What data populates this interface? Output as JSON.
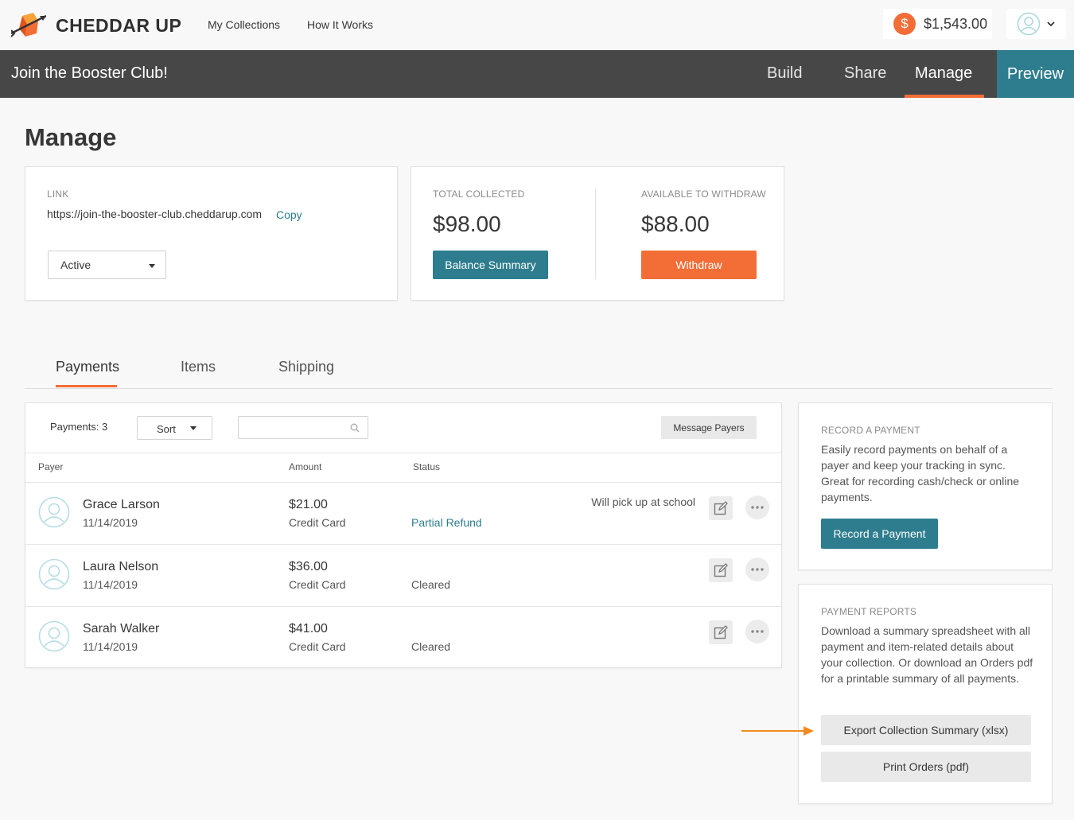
{
  "brand": {
    "name": "CHEDDAR UP",
    "accent": "#f36d36",
    "teal": "#2d7d8e"
  },
  "topnav": {
    "my_collections": "My Collections",
    "how_it_works": "How It Works"
  },
  "account": {
    "balance": "$1,543.00",
    "currency_icon": "$"
  },
  "collection": {
    "title": "Join the Booster Club!",
    "tabs": [
      "Build",
      "Share",
      "Manage",
      "Preview"
    ],
    "active_tab": "Manage"
  },
  "page": {
    "title": "Manage"
  },
  "link_card": {
    "label": "LINK",
    "url": "https://join-the-booster-club.cheddarup.com",
    "copy": "Copy",
    "status": "Active"
  },
  "totals": {
    "collected_label": "TOTAL COLLECTED",
    "collected": "$98.00",
    "balance_summary_btn": "Balance Summary",
    "available_label": "AVAILABLE TO WITHDRAW",
    "available": "$88.00",
    "withdraw_btn": "Withdraw"
  },
  "tabs": {
    "payments": "Payments",
    "items": "Items",
    "shipping": "Shipping",
    "active": "Payments"
  },
  "payments": {
    "count_label": "Payments: 3",
    "sort_label": "Sort",
    "search_placeholder": "",
    "message_btn": "Message Payers",
    "columns": {
      "payer": "Payer",
      "amount": "Amount",
      "status": "Status"
    },
    "rows": [
      {
        "name": "Grace Larson",
        "date": "11/14/2019",
        "amount": "$21.00",
        "method": "Credit Card",
        "status": "Partial Refund",
        "note": "Will pick up at school"
      },
      {
        "name": "Laura Nelson",
        "date": "11/14/2019",
        "amount": "$36.00",
        "method": "Credit Card",
        "status": "Cleared",
        "note": ""
      },
      {
        "name": "Sarah Walker",
        "date": "11/14/2019",
        "amount": "$41.00",
        "method": "Credit Card",
        "status": "Cleared",
        "note": ""
      }
    ]
  },
  "record_payment": {
    "heading": "RECORD A PAYMENT",
    "body": "Easily record payments on behalf of a payer and keep your tracking in sync. Great for recording cash/check or online payments.",
    "button": "Record a Payment"
  },
  "reports": {
    "heading": "PAYMENT REPORTS",
    "body": "Download a summary spreadsheet with all payment and item-related details about your collection. Or download an Orders pdf for a printable summary of all payments.",
    "export_btn": "Export Collection Summary (xlsx)",
    "print_btn": "Print Orders (pdf)"
  },
  "annotation": {
    "arrow_color": "#f38a1f"
  }
}
